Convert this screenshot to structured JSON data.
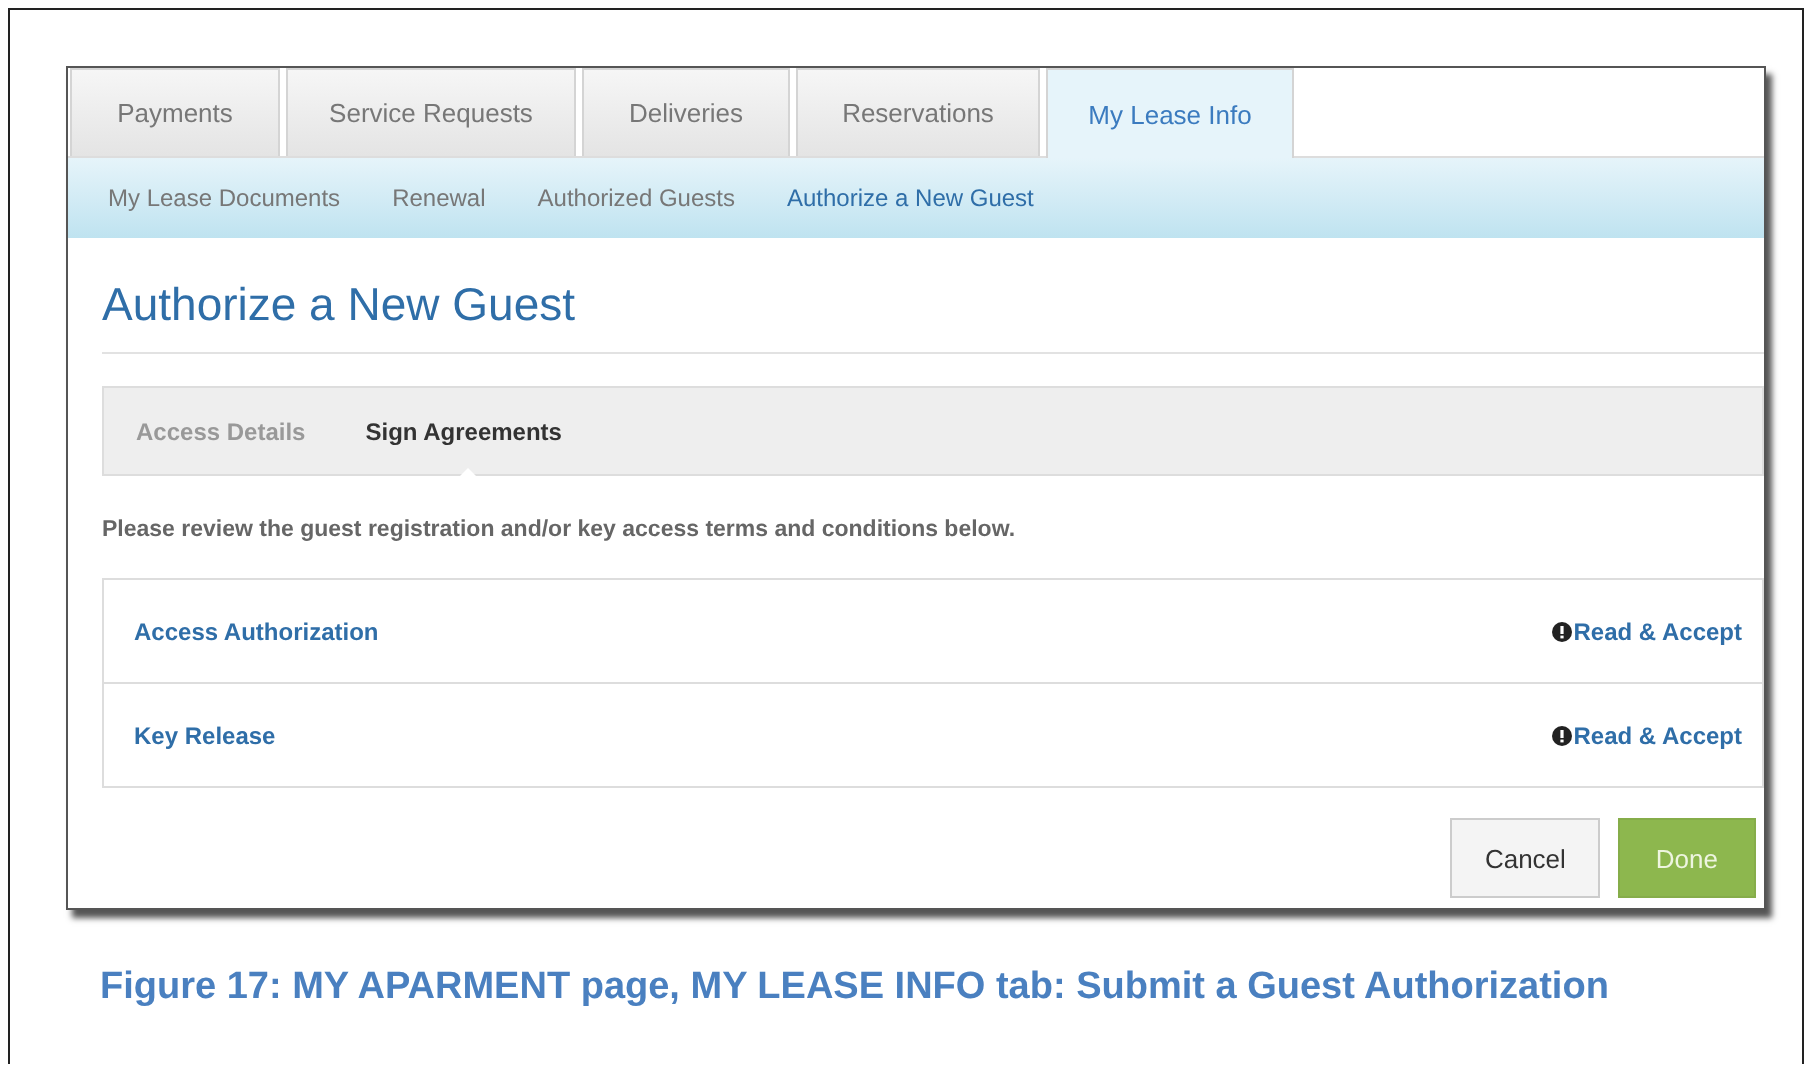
{
  "tabs": [
    {
      "label": "Payments",
      "selected": false
    },
    {
      "label": "Service Requests",
      "selected": false
    },
    {
      "label": "Deliveries",
      "selected": false
    },
    {
      "label": "Reservations",
      "selected": false
    },
    {
      "label": "My Lease Info",
      "selected": true
    }
  ],
  "subnav": [
    {
      "label": "My Lease Documents",
      "selected": false
    },
    {
      "label": "Renewal",
      "selected": false
    },
    {
      "label": "Authorized Guests",
      "selected": false
    },
    {
      "label": "Authorize a New Guest",
      "selected": true
    }
  ],
  "page_title": "Authorize a New Guest",
  "steps": [
    {
      "label": "Access Details",
      "selected": false
    },
    {
      "label": "Sign Agreements",
      "selected": true
    }
  ],
  "instructions": "Please review the guest registration and/or key access terms and conditions below.",
  "agreements": [
    {
      "name": "Access Authorization",
      "action": "Read & Accept"
    },
    {
      "name": "Key Release",
      "action": "Read & Accept"
    }
  ],
  "buttons": [
    {
      "label": "Cancel",
      "kind": "secondary"
    },
    {
      "label": "Done",
      "kind": "primary"
    }
  ],
  "caption": "Figure 17: MY APARMENT page, MY LEASE INFO tab: Submit a Guest Authorization"
}
